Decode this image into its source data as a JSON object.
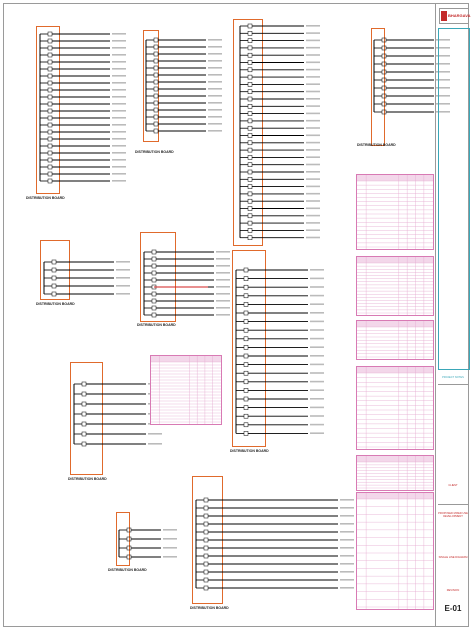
{
  "logo": {
    "text": "BHARGAVA"
  },
  "panels": [
    {
      "id": "p1",
      "caption": "DISTRIBUTION BOARD",
      "rows": 22
    },
    {
      "id": "p2",
      "caption": "DISTRIBUTION BOARD",
      "rows": 14
    },
    {
      "id": "p3",
      "caption": "",
      "rows": 30
    },
    {
      "id": "p4",
      "caption": "DISTRIBUTION BOARD",
      "rows": 10
    },
    {
      "id": "p5",
      "caption": "DISTRIBUTION BOARD",
      "rows": 5
    },
    {
      "id": "p6",
      "caption": "DISTRIBUTION BOARD",
      "rows": 10
    },
    {
      "id": "p7",
      "caption": "DISTRIBUTION BOARD",
      "rows": 20
    },
    {
      "id": "p8",
      "caption": "DISTRIBUTION BOARD",
      "rows": 7
    },
    {
      "id": "p9",
      "caption": "DISTRIBUTION BOARD",
      "rows": 4
    },
    {
      "id": "p10",
      "caption": "DISTRIBUTION BOARD",
      "rows": 12
    }
  ],
  "schedules": [
    {
      "id": "s1",
      "rows": 16
    },
    {
      "id": "s2",
      "rows": 16
    },
    {
      "id": "s3",
      "rows": 9
    },
    {
      "id": "s4",
      "rows": 16
    },
    {
      "id": "s5",
      "rows": 9
    },
    {
      "id": "s6",
      "rows": 14
    },
    {
      "id": "s7",
      "rows": 20
    }
  ],
  "titleblock": {
    "notes_label": "PROJECT NOTES",
    "client_label": "CLIENT",
    "project_name": "PROPOSED MIXED USE DEVELOPMENT",
    "drawing_title": "SINGLE LINE DIAGRAM",
    "drawing_no": "E-01",
    "revision_label": "REVISION"
  },
  "colors": {
    "panel_border": "#e06a2c",
    "schedule": "#d87ab4",
    "titleblock_accent": "#3aa7b8",
    "logo": "#c42a2a"
  }
}
